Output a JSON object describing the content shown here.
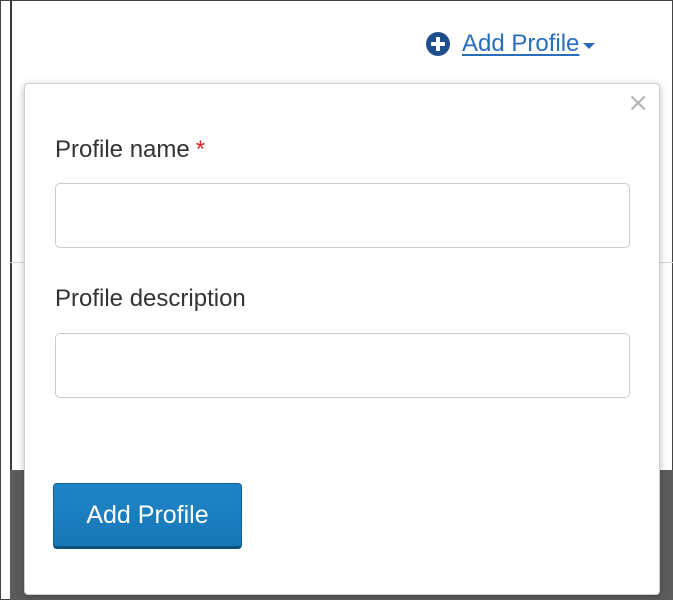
{
  "header": {
    "add_profile_link": "Add Profile"
  },
  "popover": {
    "close_glyph": "×",
    "fields": [
      {
        "label": "Profile name",
        "required_marker": "*",
        "value": "",
        "placeholder": ""
      },
      {
        "label": "Profile description",
        "value": "",
        "placeholder": ""
      }
    ],
    "submit_label": "Add Profile"
  },
  "colors": {
    "link": "#2a6ebb",
    "primary_button": "#1677b6",
    "required": "#e02020"
  },
  "icons": [
    "plus-circle-icon",
    "caret-down-icon",
    "close-icon"
  ]
}
